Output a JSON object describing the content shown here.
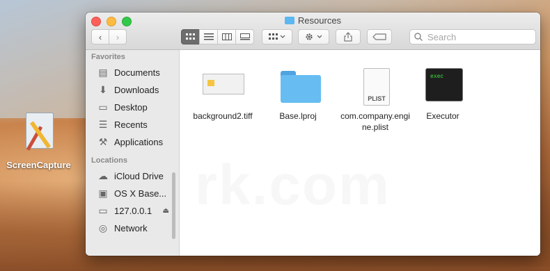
{
  "desktop": {
    "icon_label": "ScreenCapture"
  },
  "window": {
    "title": "Resources",
    "toolbar": {
      "back_glyph": "‹",
      "forward_glyph": "›",
      "search_placeholder": "Search"
    },
    "sidebar": {
      "favorites_header": "Favorites",
      "favorites": [
        {
          "label": "Documents",
          "icon": "documents-icon"
        },
        {
          "label": "Downloads",
          "icon": "downloads-icon"
        },
        {
          "label": "Desktop",
          "icon": "desktop-icon"
        },
        {
          "label": "Recents",
          "icon": "recents-icon"
        },
        {
          "label": "Applications",
          "icon": "applications-icon"
        }
      ],
      "locations_header": "Locations",
      "locations": [
        {
          "label": "iCloud Drive",
          "icon": "cloud-icon"
        },
        {
          "label": "OS X Base...",
          "icon": "disk-icon"
        },
        {
          "label": "127.0.0.1",
          "icon": "computer-icon"
        },
        {
          "label": "Network",
          "icon": "network-icon"
        }
      ]
    },
    "files": [
      {
        "name": "background2.tiff",
        "kind": "image"
      },
      {
        "name": "Base.lproj",
        "kind": "folder"
      },
      {
        "name": "com.company.engine.plist",
        "kind": "plist",
        "badge": "PLIST"
      },
      {
        "name": "Executor",
        "kind": "executable",
        "badge": "exec"
      }
    ]
  },
  "watermark": "rk.com",
  "colors": {
    "accent_folder": "#67bdf2",
    "close": "#fc605b",
    "minimize": "#fdbc40",
    "maximize": "#34c84a"
  }
}
